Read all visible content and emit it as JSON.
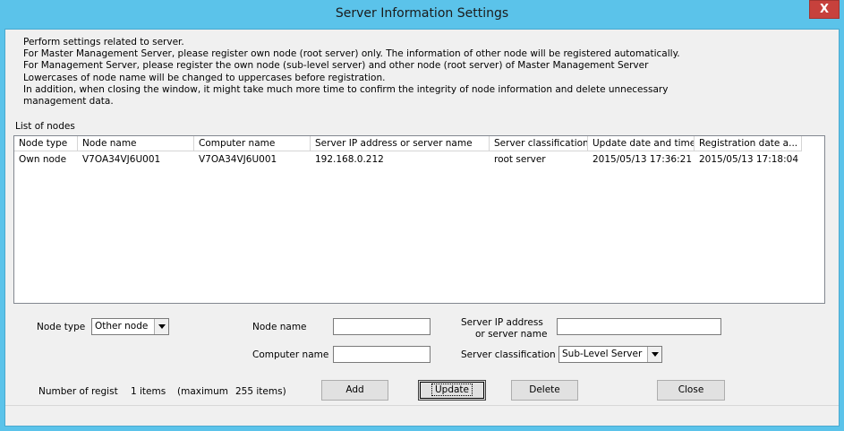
{
  "window": {
    "title": "Server Information Settings",
    "close_glyph": "X"
  },
  "description": [
    "Perform settings related to server.",
    "For Master Management Server, please register own node (root server) only. The information of other node will be registered automatically.",
    "For Management Server, please register the own node (sub-level server) and other node (root server) of Master Management Server",
    "Lowercases of node name will be changed to uppercases before registration.",
    "In addition, when closing the window, it might take much more time to confirm the integrity of node information and delete unnecessary",
    "management data."
  ],
  "list": {
    "label": "List of nodes",
    "columns": [
      "Node type",
      "Node name",
      "Computer name",
      "Server IP address or server name",
      "Server classification",
      "Update date and time",
      "Registration date a..."
    ],
    "rows": [
      [
        "Own node",
        "V7OA34VJ6U001",
        "V7OA34VJ6U001",
        "192.168.0.212",
        "root server",
        "2015/05/13 17:36:21",
        "2015/05/13 17:18:04"
      ]
    ]
  },
  "form": {
    "node_type_label": "Node type",
    "node_type_value": "Other node",
    "node_name_label": "Node name",
    "node_name_value": "",
    "computer_name_label": "Computer name",
    "computer_name_value": "",
    "server_ip_label_1": "Server IP address",
    "server_ip_label_2": "or server name",
    "server_ip_value": "",
    "server_class_label": "Server classification",
    "server_class_value": "Sub-Level Server"
  },
  "footer": {
    "count_label": "Number of regist",
    "count_value": "1 items",
    "max_label": "(maximum",
    "max_value": "255  items)"
  },
  "buttons": {
    "add": "Add",
    "update": "Update",
    "delete": "Delete",
    "close": "Close"
  }
}
